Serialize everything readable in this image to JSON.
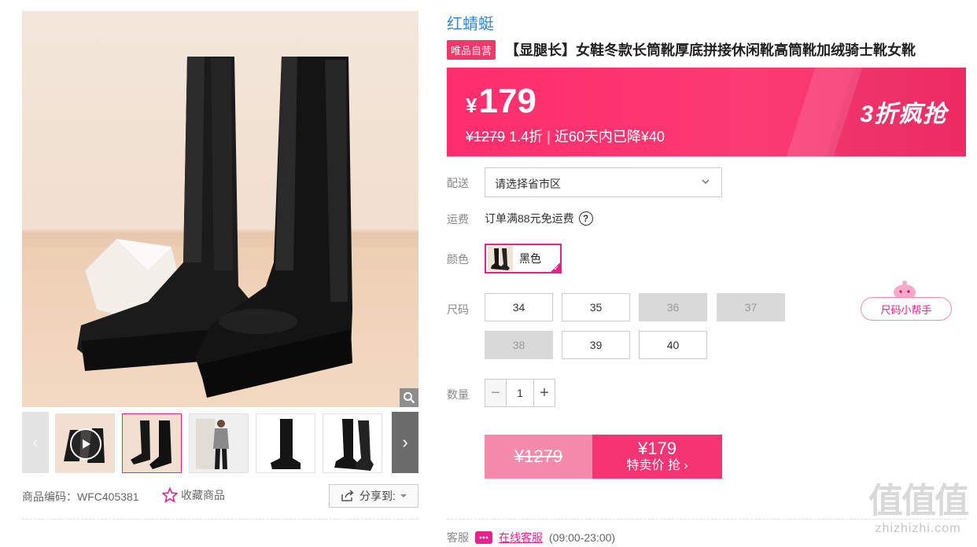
{
  "gallery": {
    "zoom_icon": "magnifier-icon",
    "thumbnails": [
      {
        "label": "video",
        "icon": "play-icon"
      },
      {
        "label": "boots-front"
      },
      {
        "label": "model"
      },
      {
        "label": "boots-side"
      },
      {
        "label": "boots-angle"
      }
    ],
    "prev_arrow": "‹",
    "next_arrow": "›"
  },
  "product_meta": {
    "sku_label": "商品编码：",
    "sku_value": "WFC405381",
    "favorite_label": "收藏商品",
    "share_label": "分享到:"
  },
  "brand": "红蜻蜓",
  "self_badge": "唯品自营",
  "title": "【显腿长】女鞋冬款长筒靴厚底拼接休闲靴高筒靴加绒骑士靴女靴",
  "price": {
    "currency": "¥",
    "current": "179",
    "original": "¥1279",
    "discount": "1.4折",
    "separator": "|",
    "drop_note": "近60天内已降¥40",
    "promo": "3折疯抢"
  },
  "delivery": {
    "label": "配送",
    "placeholder": "请选择省市区"
  },
  "shipping": {
    "label": "运费",
    "text": "订单满88元免运费",
    "help": "?"
  },
  "color": {
    "label": "颜色",
    "options": [
      {
        "name": "黑色",
        "selected": true
      }
    ]
  },
  "size": {
    "label": "尺码",
    "options": [
      {
        "value": "34",
        "available": true
      },
      {
        "value": "35",
        "available": true
      },
      {
        "value": "36",
        "available": false
      },
      {
        "value": "37",
        "available": false
      },
      {
        "value": "38",
        "available": false
      },
      {
        "value": "39",
        "available": true
      },
      {
        "value": "40",
        "available": true
      }
    ],
    "helper": "尺码小帮手"
  },
  "quantity": {
    "label": "数量",
    "value": "1",
    "minus": "−",
    "plus": "+"
  },
  "buy": {
    "original": "¥1279",
    "current": "¥179",
    "cta": "特卖价 抢 ›"
  },
  "service": {
    "label": "客服",
    "link": "在线客服",
    "hours": "(09:00-23:00)"
  },
  "watermark": {
    "big": "值值值",
    "small": "zhizhizhi.com"
  },
  "colors": {
    "accent": "#e3218f",
    "banner": "#ff2d6d",
    "brand": "#3a88d4"
  }
}
